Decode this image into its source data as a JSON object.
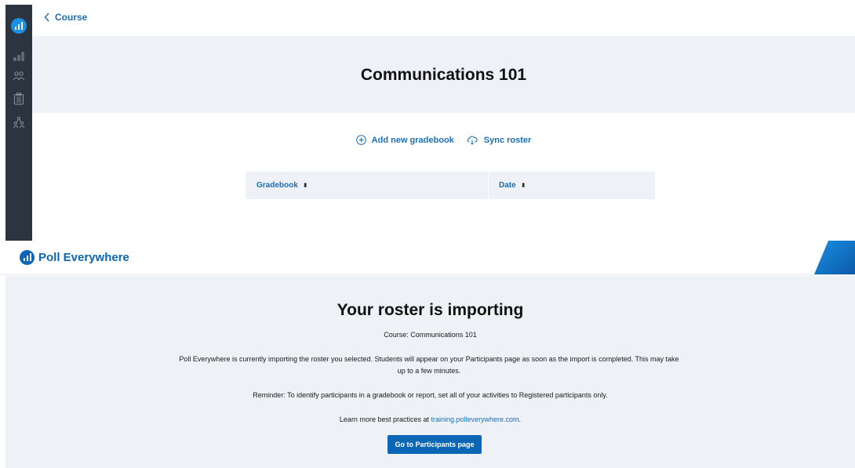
{
  "top_app": {
    "back_label": "Course",
    "course_title": "Communications 101",
    "actions": {
      "add_gradebook": "Add new gradebook",
      "sync_roster": "Sync roster"
    },
    "table": {
      "columns": [
        "Gradebook",
        "Date"
      ],
      "sort_glyph": "⬍",
      "rows": []
    },
    "sidebar_icons": [
      "polls-icon",
      "participants-icon",
      "reports-icon",
      "gradebooks-icon"
    ]
  },
  "import_page": {
    "brand": "Poll Everywhere",
    "heading": "Your roster is importing",
    "course_line": "Course: Communications 101",
    "message": "Poll Everywhere is currently importing the roster you selected. Students will appear on your Participants page as soon as the import is completed. This may take up to a few minutes.",
    "reminder": "Reminder: To identify participants in a gradebook or report, set all of your activities to Registered participants only.",
    "learn_prefix": "Learn more best practices at ",
    "learn_link": "training.polleverywhere.com",
    "learn_suffix": ".",
    "cta_label": "Go to Participants page"
  },
  "colors": {
    "brand_blue": "#0b67b5",
    "link_blue": "#1a6fb5",
    "sidebar": "#2c3440",
    "panel": "#eef1f5"
  }
}
